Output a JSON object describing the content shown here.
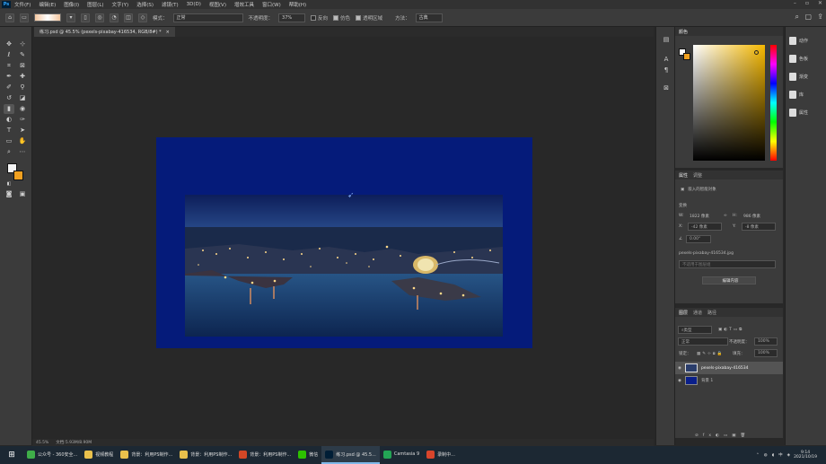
{
  "app": {
    "logo": "Ps"
  },
  "menu": [
    "文件(F)",
    "编辑(E)",
    "图像(I)",
    "图层(L)",
    "文字(Y)",
    "选择(S)",
    "滤镜(T)",
    "3D(D)",
    "视图(V)",
    "增效工具",
    "窗口(W)",
    "帮助(H)"
  ],
  "options": {
    "mode_label": "模式：",
    "mode_value": "正常",
    "opacity_label": "不透明度：",
    "opacity_value": "37%",
    "reverse_label": "反向",
    "dither_label": "仿色",
    "transparency_label": "透明区域",
    "method_label": "方法：",
    "method_value": "古典"
  },
  "document": {
    "tab_title": "练习.psd @ 45.5% (pexels-pixabay-416534, RGB/8#) *",
    "close": "×"
  },
  "status": {
    "zoom": "45.5%",
    "doc_info": "文档:5.93M/8.90M"
  },
  "color_panel": {
    "tab": "颜色"
  },
  "properties": {
    "tabs": [
      "属性",
      "调整"
    ],
    "title": "嵌入的智能对象",
    "transform_label": "变换",
    "w_label": "W:",
    "w_value": "1822 像素",
    "h_label": "H:",
    "h_value": "986 像素",
    "x_label": "X:",
    "x_value": "-42 像素",
    "y_label": "Y:",
    "y_value": "-8 像素",
    "angle": "0.00°",
    "filename": "pexels-pixabay-416534.jpg",
    "comp_placeholder": "不适用于图层组",
    "edit_button": "编辑内容"
  },
  "layers": {
    "tabs": [
      "图层",
      "通道",
      "路径"
    ],
    "kind": "类型",
    "blend": "正常",
    "opacity_label": "不透明度：",
    "opacity_value": "100%",
    "lock_label": "锁定：",
    "fill_label": "填充：",
    "fill_value": "100%",
    "items": [
      {
        "name": "pexels-pixabay-416534",
        "color": "#2a3d6b"
      },
      {
        "name": "背景 1",
        "color": "#0a1f8a"
      }
    ]
  },
  "right_panel": {
    "items": [
      "动作",
      "色板",
      "渐变",
      "库",
      "属性"
    ]
  },
  "taskbar": {
    "items": [
      {
        "label": "公众号 - 360安全...",
        "color": "#3fae49"
      },
      {
        "label": "视频教程",
        "color": "#e8c04c"
      },
      {
        "label": "背景：利用PS制作...",
        "color": "#e8c04c"
      },
      {
        "label": "背景：利用PS制作...",
        "color": "#e8c04c"
      },
      {
        "label": "背景：利用PS制作...",
        "color": "#d24726"
      },
      {
        "label": "微信",
        "color": "#2dc100"
      },
      {
        "label": "练习.psd @ 45.5...",
        "color": "#001e36",
        "active": true
      },
      {
        "label": "Camtasia 9",
        "color": "#23a455"
      },
      {
        "label": "录制中...",
        "color": "#d9452b"
      }
    ],
    "ime": "中",
    "time": "9:14",
    "date": "2021/10/19"
  }
}
